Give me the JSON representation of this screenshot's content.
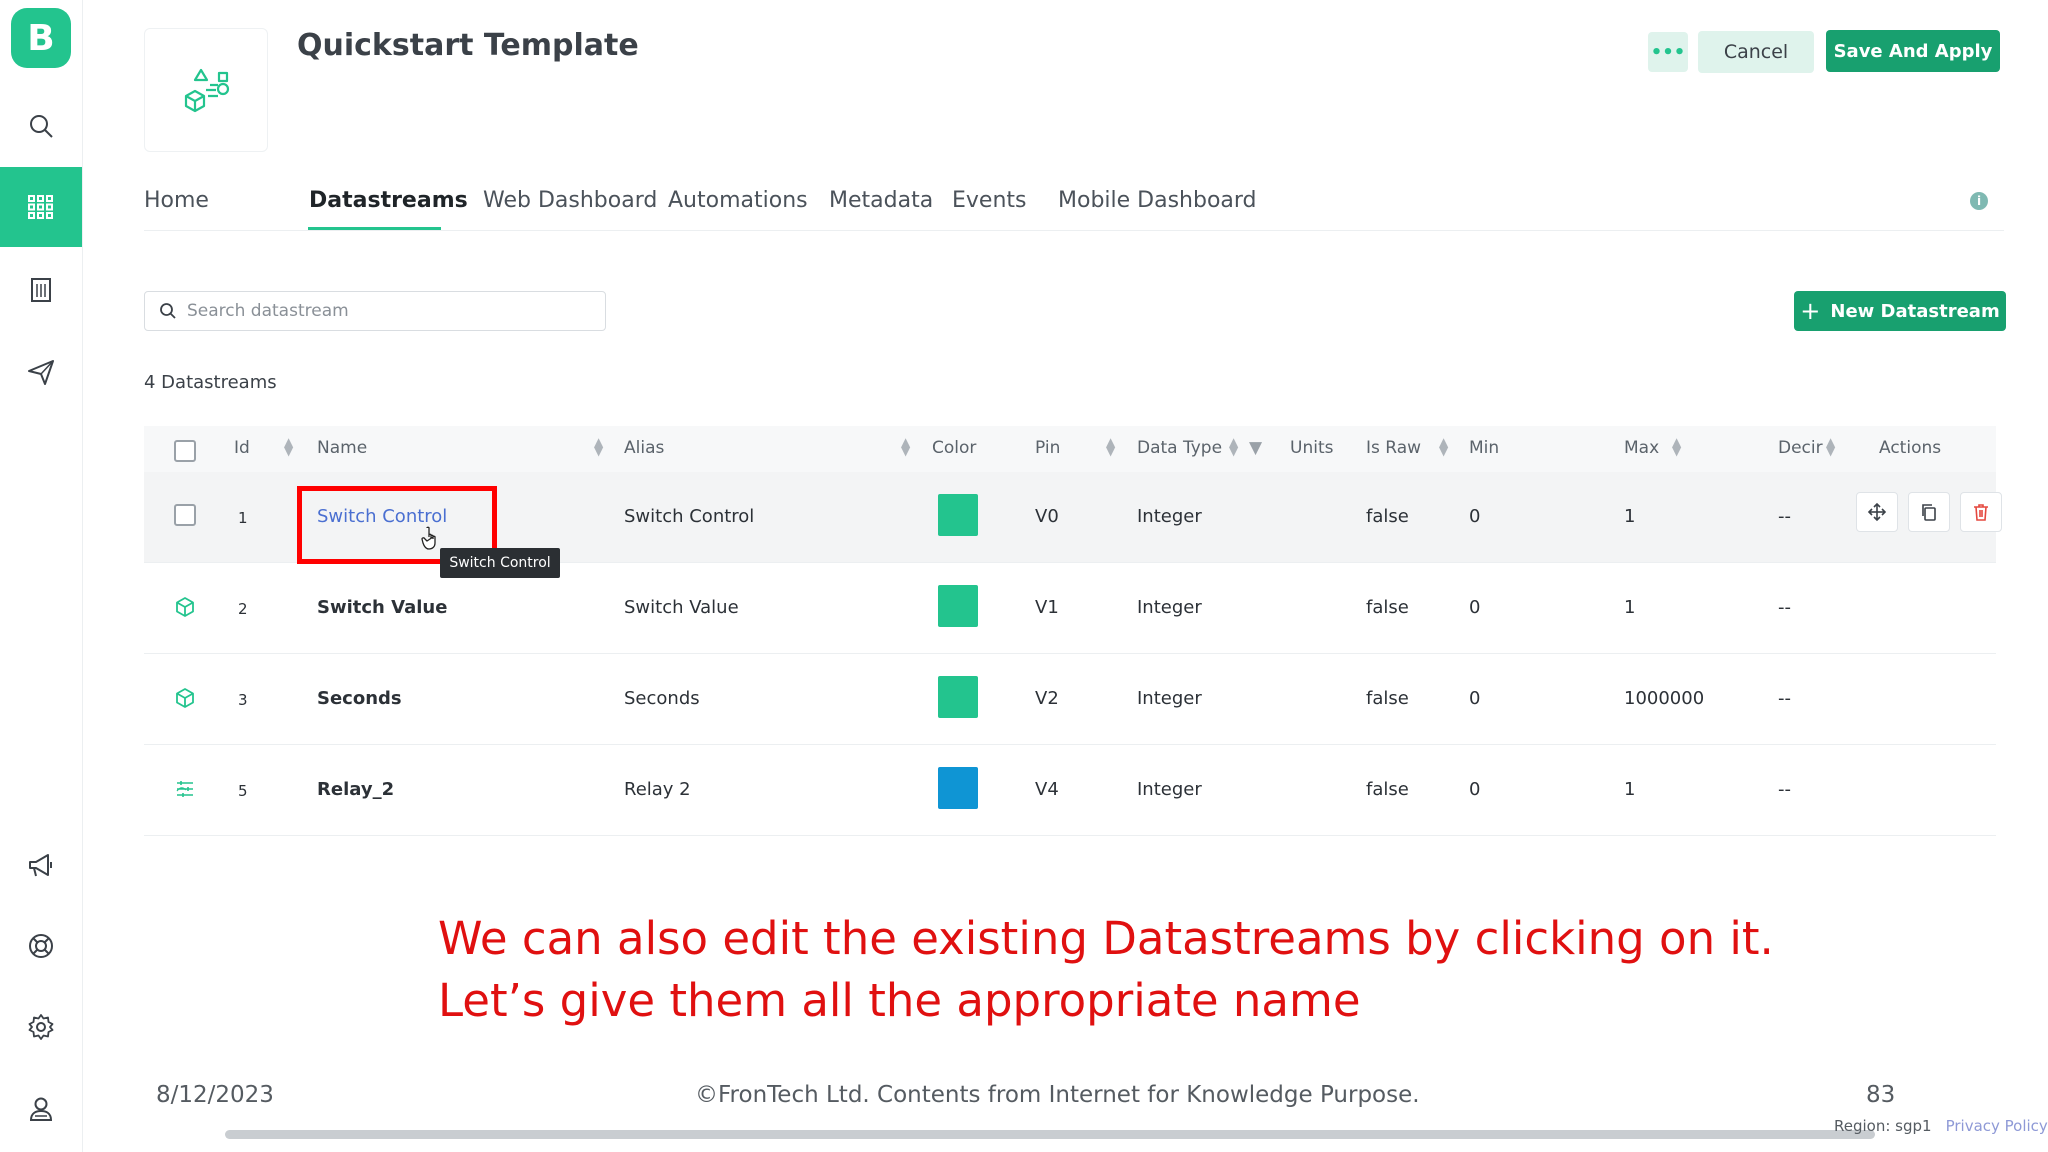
{
  "sidebar": {
    "logo_letter": "B",
    "items": [
      {
        "icon": "search-icon"
      },
      {
        "icon": "grid-icon",
        "active": true
      },
      {
        "icon": "building-icon"
      },
      {
        "icon": "send-icon"
      },
      {
        "icon": "megaphone-icon"
      },
      {
        "icon": "lifebuoy-icon"
      },
      {
        "icon": "gear-icon"
      },
      {
        "icon": "user-icon"
      }
    ]
  },
  "header": {
    "title": "Quickstart Template",
    "more_label": "•••",
    "cancel_label": "Cancel",
    "save_label": "Save And Apply"
  },
  "tabs": [
    "Home",
    "Datastreams",
    "Web Dashboard",
    "Automations",
    "Metadata",
    "Events",
    "Mobile Dashboard"
  ],
  "active_tab": "Datastreams",
  "search": {
    "placeholder": "Search datastream"
  },
  "new_button_label": "New Datastream",
  "count_label": "4 Datastreams",
  "table": {
    "columns": [
      "Id",
      "Name",
      "Alias",
      "Color",
      "Pin",
      "Data Type",
      "Units",
      "Is Raw",
      "Min",
      "Max",
      "Decir",
      "Actions"
    ],
    "rows": [
      {
        "id": "1",
        "name": "Switch Control",
        "alias": "Switch Control",
        "color": "#23c48e",
        "pin": "V0",
        "data_type": "Integer",
        "units": "",
        "is_raw": "false",
        "min": "0",
        "max": "1",
        "decimals": "--",
        "icon": "checkbox"
      },
      {
        "id": "2",
        "name": "Switch Value",
        "alias": "Switch Value",
        "color": "#23c48e",
        "pin": "V1",
        "data_type": "Integer",
        "units": "",
        "is_raw": "false",
        "min": "0",
        "max": "1",
        "decimals": "--",
        "icon": "cube-icon"
      },
      {
        "id": "3",
        "name": "Seconds",
        "alias": "Seconds",
        "color": "#23c48e",
        "pin": "V2",
        "data_type": "Integer",
        "units": "",
        "is_raw": "false",
        "min": "0",
        "max": "1000000",
        "decimals": "--",
        "icon": "cube-icon"
      },
      {
        "id": "5",
        "name": "Relay_2",
        "alias": "Relay 2",
        "color": "#0f95d4",
        "pin": "V4",
        "data_type": "Integer",
        "units": "",
        "is_raw": "false",
        "min": "0",
        "max": "1",
        "decimals": "--",
        "icon": "sliders-icon"
      }
    ]
  },
  "tooltip_text": "Switch Control",
  "overlay_text": [
    "We can also edit the existing Datastreams by clicking on it.",
    "Let’s give them all the appropriate name"
  ],
  "footer": {
    "date": "8/12/2023",
    "copyright": "©FronTech Ltd. Contents from Internet for Knowledge Purpose.",
    "page": "83",
    "region": "Region: sgp1",
    "privacy": "Privacy Policy"
  },
  "colors": {
    "brand": "#23c48e",
    "brand_dark": "#18a06f",
    "annotation": "#e01010"
  }
}
